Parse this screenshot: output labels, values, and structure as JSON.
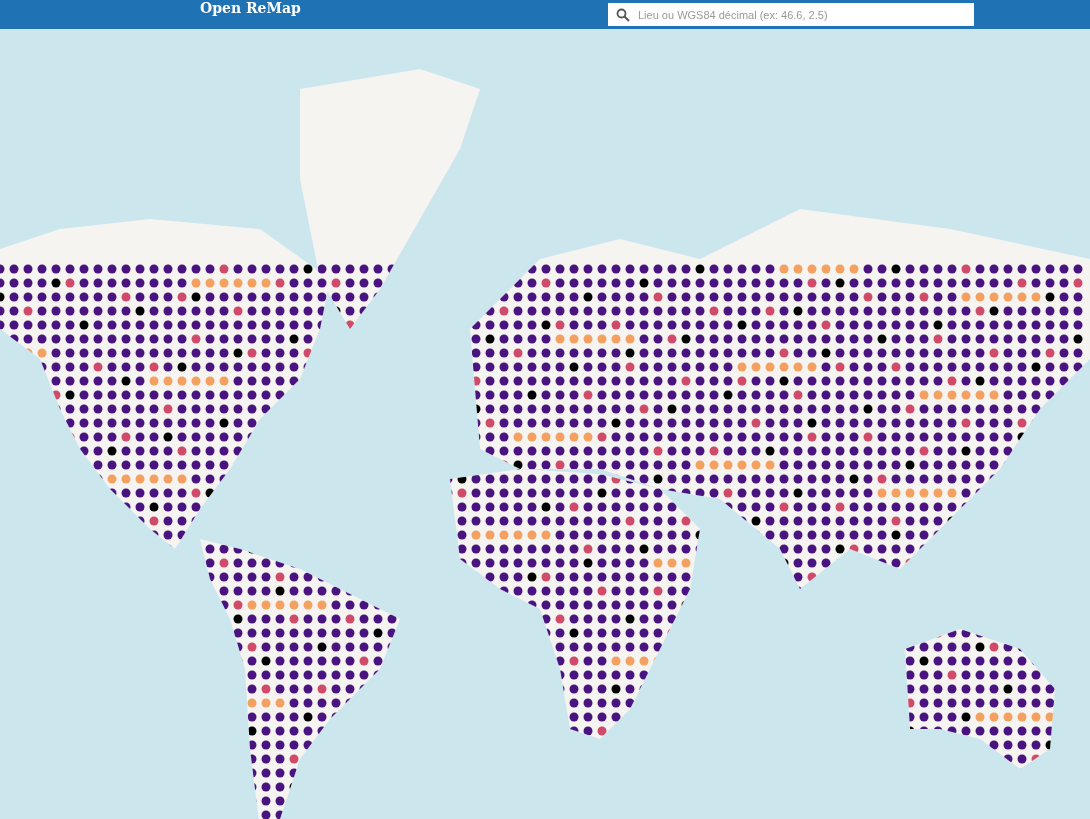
{
  "header": {
    "title": "Open ReMap",
    "search": {
      "placeholder": "Lieu ou WGS84 décimal (ex: 46.6, 2.5)"
    }
  }
}
